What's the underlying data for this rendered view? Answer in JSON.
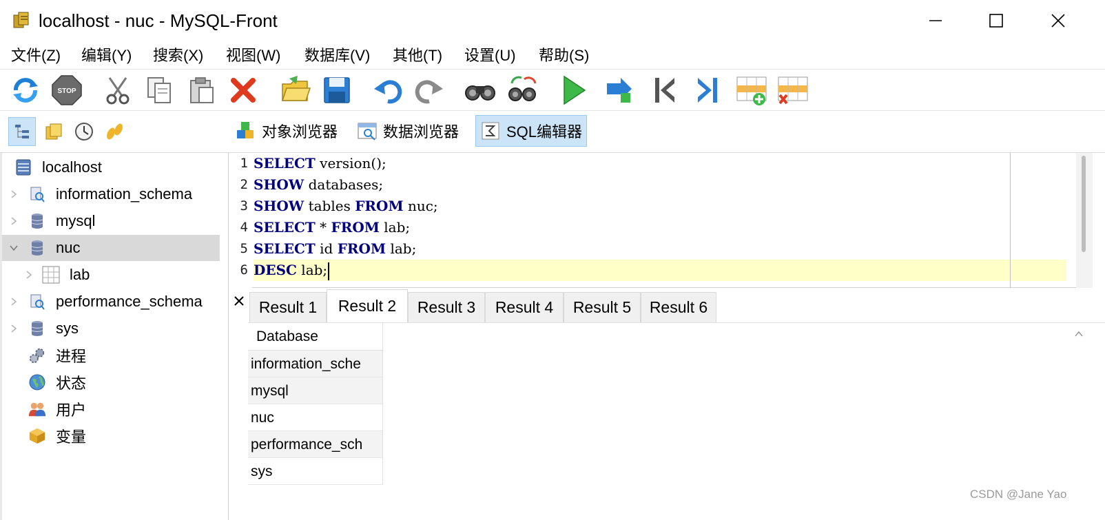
{
  "window": {
    "title": "localhost - nuc - MySQL-Front",
    "controls": [
      "minimize-icon",
      "maximize-icon",
      "close-icon"
    ]
  },
  "menu": [
    "文件(Z)",
    "编辑(Y)",
    "搜索(X)",
    "视图(W)",
    "数据库(V)",
    "其他(T)",
    "设置(U)",
    "帮助(S)"
  ],
  "toolbar": {
    "icons": [
      "refresh-icon",
      "stop-icon",
      "cut-icon",
      "copy-icon",
      "paste-icon",
      "delete-icon",
      "open-icon",
      "save-icon",
      "undo-icon",
      "redo-icon",
      "find-icon",
      "replace-icon",
      "run-icon",
      "run-selection-icon",
      "first-icon",
      "last-icon",
      "insert-row-icon",
      "delete-row-icon"
    ],
    "stop_label": "STOP"
  },
  "views": {
    "side_icons": [
      "tree-view-icon",
      "bookmarks-icon",
      "history-icon",
      "sql-history-icon"
    ],
    "tabs": [
      {
        "label": "对象浏览器",
        "icon": "object-browser-icon"
      },
      {
        "label": "数据浏览器",
        "icon": "data-browser-icon"
      },
      {
        "label": "SQL编辑器",
        "icon": "sql-editor-icon",
        "active": true
      }
    ]
  },
  "tree": {
    "root": "localhost",
    "databases": [
      "information_schema",
      "mysql",
      "nuc",
      "performance_schema",
      "sys"
    ],
    "nuc_children": [
      "lab"
    ],
    "selected": "nuc",
    "items": [
      "进程",
      "状态",
      "用户",
      "变量"
    ]
  },
  "editor": {
    "lines": [
      {
        "num": "1",
        "kw1": "SELECT",
        "rest": " version();"
      },
      {
        "num": "2",
        "kw1": "SHOW",
        "rest": " databases;"
      },
      {
        "num": "3",
        "kw1": "SHOW",
        "rest": " tables ",
        "kw2": "FROM",
        "rest2": " nuc;"
      },
      {
        "num": "4",
        "kw1": "SELECT",
        "rest": " * ",
        "kw2": "FROM",
        "rest2": " lab;"
      },
      {
        "num": "5",
        "kw1": "SELECT",
        "rest": " id ",
        "kw2": "FROM",
        "rest2": " lab;"
      },
      {
        "num": "6",
        "kw1": "DESC",
        "rest": " lab;"
      }
    ],
    "current_line": 6
  },
  "results": {
    "close_symbol": "×",
    "tabs": [
      "Result 1",
      "Result 2",
      "Result 3",
      "Result 4",
      "Result 5",
      "Result 6"
    ],
    "active_tab": "Result 2",
    "column": "Database",
    "rows": [
      "information_sche",
      "mysql",
      "nuc",
      "performance_sch",
      "sys"
    ]
  },
  "watermark": "CSDN @Jane Yao",
  "colors": {
    "keyword": "#00007f",
    "current_line": "#ffffc8",
    "selection": "#cce4f7",
    "tree_selected": "#d9d9d9"
  }
}
